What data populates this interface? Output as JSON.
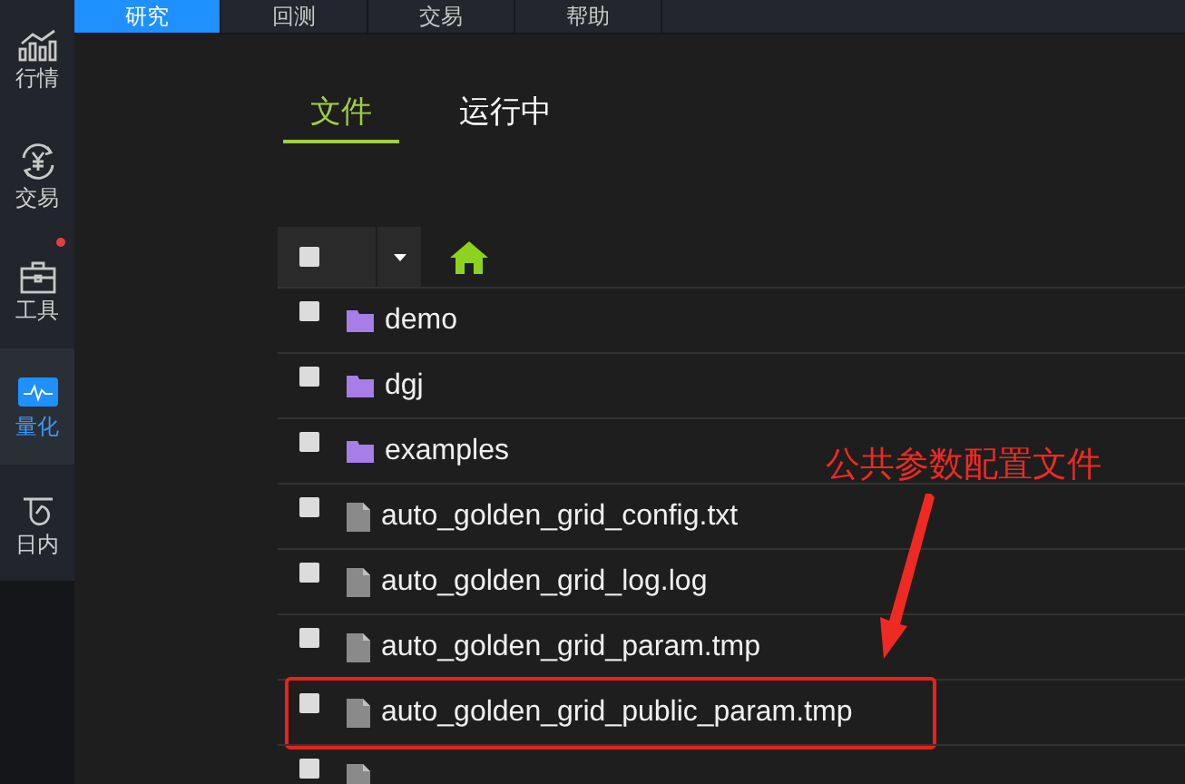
{
  "sidebar": {
    "items": [
      {
        "label": "行情",
        "kind": "chart",
        "selected": false,
        "badge": false
      },
      {
        "label": "交易",
        "kind": "exchange",
        "selected": false,
        "badge": false
      },
      {
        "label": "工具",
        "kind": "toolbox",
        "selected": false,
        "badge": true
      },
      {
        "label": "量化",
        "kind": "monitor",
        "selected": true,
        "badge": false
      },
      {
        "label": "日内",
        "kind": "intraday",
        "selected": false,
        "badge": false
      }
    ]
  },
  "top_tabs": [
    {
      "label": "研究",
      "selected": true
    },
    {
      "label": "回测",
      "selected": false
    },
    {
      "label": "交易",
      "selected": false
    },
    {
      "label": "帮助",
      "selected": false
    }
  ],
  "sub_tabs": [
    {
      "label": "文件",
      "selected": true
    },
    {
      "label": "运行中",
      "selected": false
    }
  ],
  "toolbar": {
    "select_all": {
      "checked": false
    }
  },
  "files": [
    {
      "kind": "folder",
      "name": "demo",
      "checked": false,
      "outlined": false
    },
    {
      "kind": "folder",
      "name": "dgj",
      "checked": false,
      "outlined": false
    },
    {
      "kind": "folder",
      "name": "examples",
      "checked": false,
      "outlined": false
    },
    {
      "kind": "file",
      "name": "auto_golden_grid_config.txt",
      "checked": false,
      "outlined": false
    },
    {
      "kind": "file",
      "name": "auto_golden_grid_log.log",
      "checked": false,
      "outlined": false
    },
    {
      "kind": "file",
      "name": "auto_golden_grid_param.tmp",
      "checked": false,
      "outlined": false
    },
    {
      "kind": "file",
      "name": "auto_golden_grid_public_param.tmp",
      "checked": false,
      "outlined": true
    },
    {
      "kind": "file",
      "checked": false,
      "outlined": false
    }
  ],
  "annotation": {
    "text": "公共参数配置文件"
  }
}
